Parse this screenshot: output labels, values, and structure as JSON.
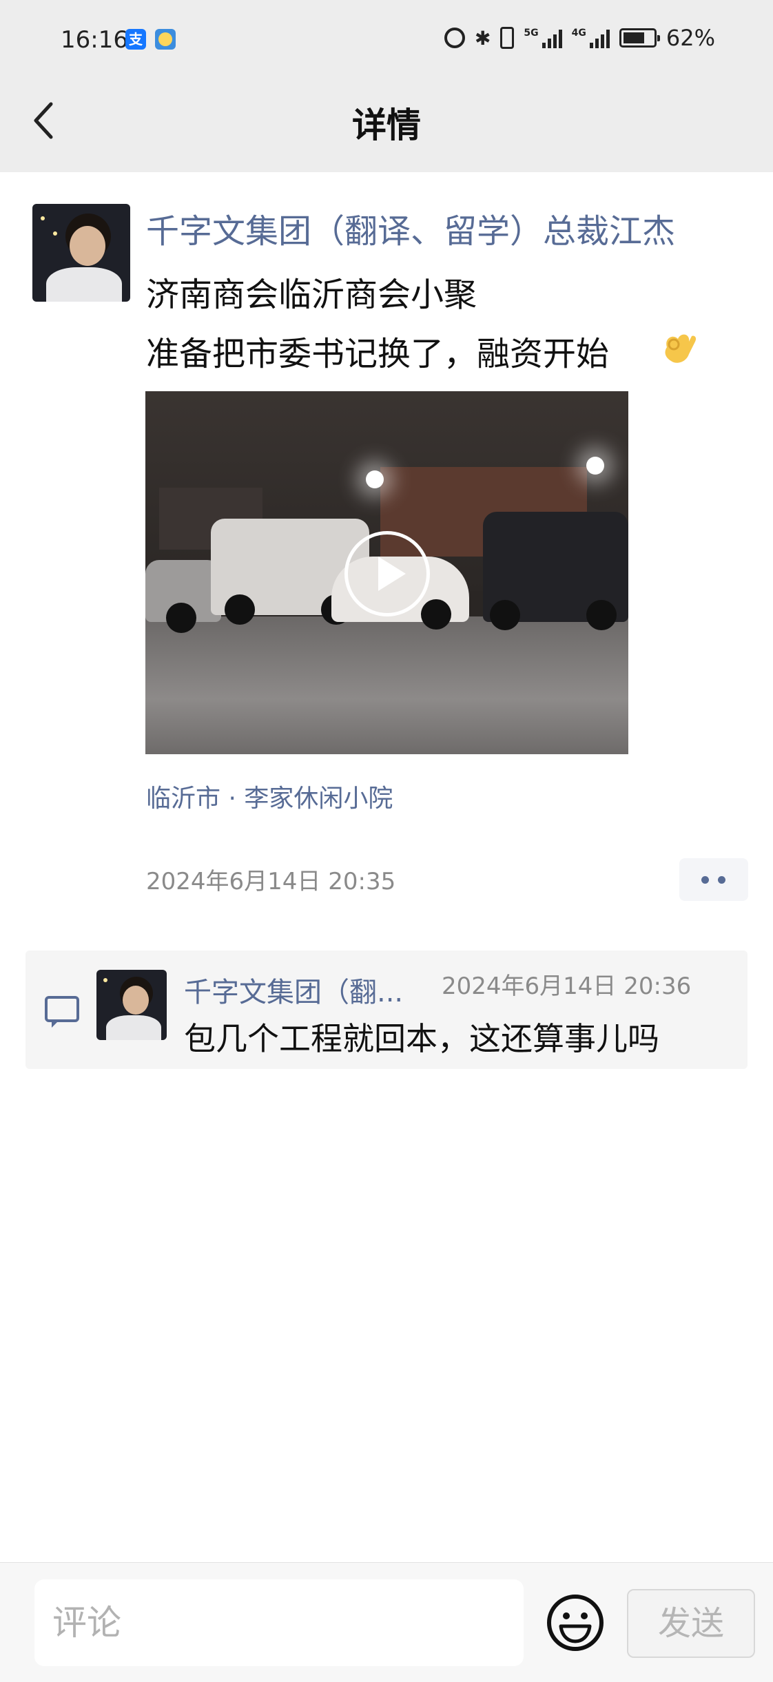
{
  "status_bar": {
    "time": "16:16",
    "alipay_glyph": "支",
    "battery_text": "62%",
    "signal_1_label": "5G",
    "signal_2_label": "4G"
  },
  "header": {
    "title": "详情"
  },
  "post": {
    "author": "千字文集团（翻译、留学）总裁江杰",
    "line1": "济南商会临沂商会小聚",
    "line2": "准备把市委书记换了，融资开始",
    "emoji": "ok-hand-emoji",
    "location": "临沂市 · 李家休闲小院",
    "time": "2024年6月14日 20:35"
  },
  "comments": [
    {
      "author": "千字文集团（翻...",
      "time": "2024年6月14日 20:36",
      "text": "包几个工程就回本，这还算事儿吗"
    }
  ],
  "bottom_bar": {
    "input_placeholder": "评论",
    "send_label": "发送"
  },
  "colors": {
    "link": "#576b95",
    "header_bg": "#ededed",
    "comment_bg": "#f5f5f5"
  }
}
